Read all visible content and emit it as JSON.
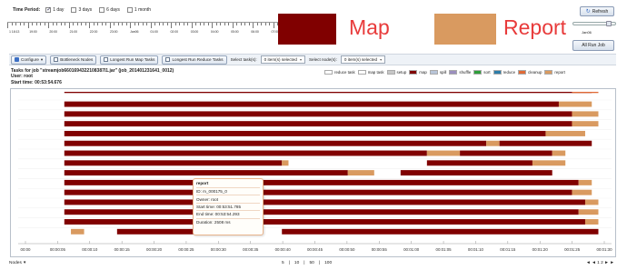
{
  "time_period": {
    "label": "Time Period:",
    "options": [
      {
        "label": "1 day",
        "checked": true
      },
      {
        "label": "3 days",
        "checked": false
      },
      {
        "label": "6 days",
        "checked": false
      },
      {
        "label": "1 month",
        "checked": false
      }
    ]
  },
  "refresh_label": "Refresh",
  "timeline": {
    "labels": [
      "1 18:13",
      "19:00",
      "20:00",
      "21:00",
      "22:00",
      "23:00",
      "Jan06",
      "01:00",
      "02:00",
      "03:00",
      "04:00",
      "05:00",
      "06:00",
      "07:00",
      "08:00"
    ],
    "right_date": "Jan06"
  },
  "all_run_job_label": "All Run Job",
  "overlay_legend": {
    "map": {
      "label": "Map",
      "color": "#800000"
    },
    "report": {
      "label": "Report",
      "color": "#d99a60"
    }
  },
  "controls": {
    "configure": "Configure",
    "bottleneck_nodes": "Bottleneck Nodes",
    "longest_map_tasks": "Longest Run Map Tasks",
    "longest_reduce_tasks": "Longest Run Reduce Tasks",
    "select_tasks_label": "Select task(s):",
    "select_tasks_value": "0 item(s) selected",
    "select_nodes_label": "Select node(s):",
    "select_nodes_value": "0 item(s) selected"
  },
  "task_info": {
    "title": "Tasks for job \"streamjob6601694322108387l1.jar\" (job_201401231641_0012)",
    "user": "User: root",
    "start_time": "Start time: 00:53:54.676"
  },
  "category_legend": [
    {
      "label": "reduce task",
      "color": "#ffffff"
    },
    {
      "label": "map task",
      "color": "#ffffff"
    },
    {
      "label": "setup",
      "color": "#c7c7c7"
    },
    {
      "label": "map",
      "color": "#800000"
    },
    {
      "label": "spill",
      "color": "#b8c5d8"
    },
    {
      "label": "shuffle",
      "color": "#9b8fbe"
    },
    {
      "label": "sort",
      "color": "#2e9e3a"
    },
    {
      "label": "reduce",
      "color": "#2d7da8"
    },
    {
      "label": "cleanup",
      "color": "#e06a36"
    },
    {
      "label": "report",
      "color": "#d99a60"
    }
  ],
  "chart_data": {
    "type": "gantt",
    "x_axis_labels": [
      "00:00",
      "00:00:05",
      "00:00:10",
      "00:00:15",
      "00:00:20",
      "00:00:25",
      "00:00:30",
      "00:00:35",
      "00:00:40",
      "00:00:45",
      "00:00:50",
      "00:00:55",
      "00:01:00",
      "00:01:05",
      "00:01:10",
      "00:01:15",
      "00:01:20",
      "00:01:25",
      "00:01:30"
    ],
    "x_range_seconds": [
      0,
      90
    ],
    "colors": {
      "map": "#800000",
      "report": "#d99a60"
    },
    "tasks": [
      {
        "segments": [
          {
            "type": "map",
            "start": 7,
            "end": 82
          },
          {
            "type": "report",
            "start": 82,
            "end": 87
          }
        ]
      },
      {
        "segments": [
          {
            "type": "map",
            "start": 7,
            "end": 84
          },
          {
            "type": "report",
            "start": 84,
            "end": 88
          }
        ]
      },
      {
        "segments": [
          {
            "type": "map",
            "start": 7,
            "end": 84
          },
          {
            "type": "report",
            "start": 84,
            "end": 88
          }
        ]
      },
      {
        "segments": [
          {
            "type": "map",
            "start": 7,
            "end": 80
          },
          {
            "type": "report",
            "start": 80,
            "end": 86
          }
        ]
      },
      {
        "segments": [
          {
            "type": "map",
            "start": 7,
            "end": 71
          },
          {
            "type": "report",
            "start": 71,
            "end": 73
          },
          {
            "type": "map",
            "start": 73,
            "end": 87
          }
        ]
      },
      {
        "segments": [
          {
            "type": "map",
            "start": 7,
            "end": 62
          },
          {
            "type": "report",
            "start": 62,
            "end": 67
          },
          {
            "type": "map",
            "start": 67,
            "end": 81
          },
          {
            "type": "report",
            "start": 81,
            "end": 83
          }
        ]
      },
      {
        "segments": [
          {
            "type": "map",
            "start": 7,
            "end": 40
          },
          {
            "type": "report",
            "start": 40,
            "end": 41
          },
          {
            "type": "map",
            "start": 62,
            "end": 78
          },
          {
            "type": "report",
            "start": 78,
            "end": 83
          }
        ]
      },
      {
        "segments": [
          {
            "type": "map",
            "start": 7,
            "end": 50
          },
          {
            "type": "report",
            "start": 50,
            "end": 54
          },
          {
            "type": "map",
            "start": 58,
            "end": 81
          }
        ]
      },
      {
        "segments": [
          {
            "type": "map",
            "start": 7,
            "end": 85
          },
          {
            "type": "report",
            "start": 85,
            "end": 87
          }
        ]
      },
      {
        "segments": [
          {
            "type": "map",
            "start": 7,
            "end": 84
          },
          {
            "type": "report",
            "start": 84,
            "end": 87
          }
        ]
      },
      {
        "segments": [
          {
            "type": "map",
            "start": 7,
            "end": 86
          },
          {
            "type": "report",
            "start": 86,
            "end": 88
          }
        ]
      },
      {
        "segments": [
          {
            "type": "map",
            "start": 7,
            "end": 85
          },
          {
            "type": "report",
            "start": 85,
            "end": 88
          }
        ]
      },
      {
        "segments": [
          {
            "type": "map",
            "start": 7,
            "end": 86
          },
          {
            "type": "report",
            "start": 86,
            "end": 88
          }
        ]
      },
      {
        "segments": [
          {
            "type": "report",
            "start": 8,
            "end": 10
          },
          {
            "type": "map",
            "start": 15,
            "end": 32
          },
          {
            "type": "report",
            "start": 32,
            "end": 34
          },
          {
            "type": "map",
            "start": 40,
            "end": 88
          }
        ]
      }
    ]
  },
  "tooltip": {
    "title": "report",
    "id": "ID: m_000175_0",
    "owner": "Owner: root",
    "start": "Start time: 00:53:51.785",
    "end": "End time: 00:53:54.293",
    "duration": "Duration: 2508 ms"
  },
  "status_bar": {
    "nodes_label": "Nodes",
    "page_sizes": [
      "5",
      "10",
      "50",
      "100"
    ],
    "pager": "◄ ◄ 1 2 ► ►"
  }
}
